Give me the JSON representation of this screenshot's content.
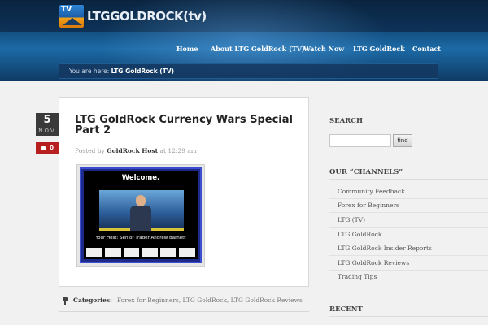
{
  "header": {
    "logo_badge": "TV",
    "logo_text": "LTGGOLDROCK(tv)",
    "nav": [
      "Home",
      "About LTG GoldRock (TV)",
      "Watch Now",
      "LTG GoldRock",
      "Contact"
    ]
  },
  "breadcrumb": {
    "prefix": "You are here:",
    "current": "LTG GoldRock (TV)"
  },
  "post": {
    "date_day": "5",
    "date_month": "NOV",
    "comments": "0",
    "title": "LTG GoldRock Currency Wars Special Part 2",
    "meta_prefix": "Posted by",
    "author": "GoldRock Host",
    "meta_at": "at 12:29 am",
    "video": {
      "welcome": "Welcome.",
      "caption": "Your Host: Senior Trader Andrew Barnett"
    },
    "categories_label": "Categories:",
    "categories": "Forex for Beginners, LTG GoldRock, LTG GoldRock Reviews"
  },
  "sidebar": {
    "search_heading": "SEARCH",
    "search_button": "find",
    "channels_heading": "OUR “CHANNELS”",
    "channels": [
      "Community Feedback",
      "Forex for Beginners",
      "LTG (TV)",
      "LTG GoldRock",
      "LTG GoldRock Insider Reports",
      "LTG GoldRock Reviews",
      "Trading Tips"
    ],
    "recent_heading": "RECENT"
  },
  "colors": {
    "accent_red": "#b81f1f",
    "header_blue": "#124a7a"
  }
}
